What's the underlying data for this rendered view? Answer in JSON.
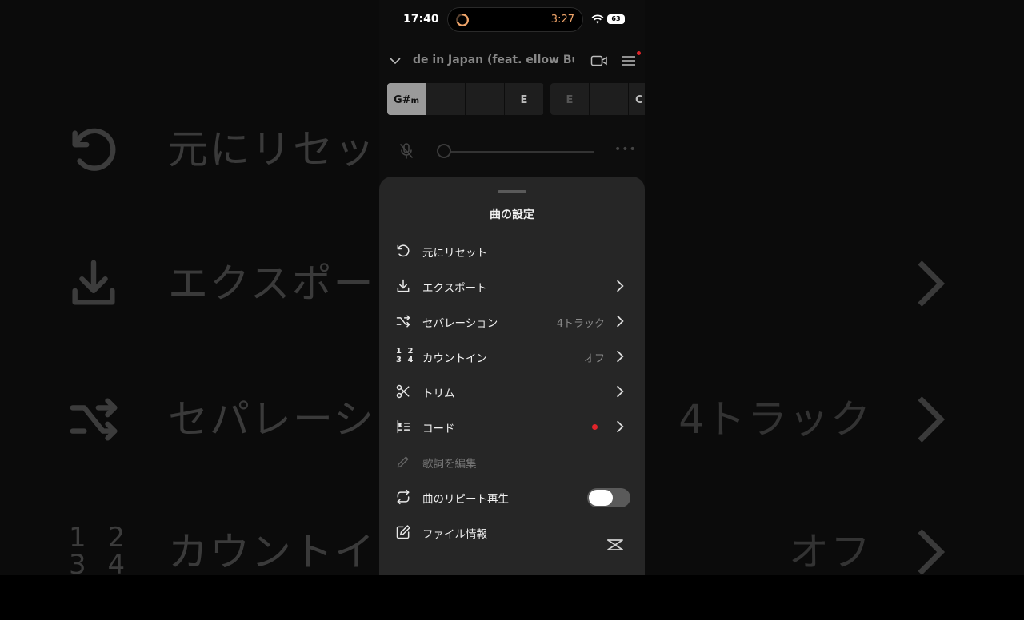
{
  "status_bar": {
    "time": "17:40",
    "timer": "3:27",
    "battery": "63"
  },
  "header": {
    "song_title": "de in Japan (feat. ellow Buck"
  },
  "chords": {
    "group1": [
      "G#m",
      "",
      "",
      "E"
    ],
    "group2": [
      "E",
      "",
      "C"
    ]
  },
  "sheet": {
    "title": "曲の設定",
    "items": [
      {
        "label": "元にリセット",
        "value": "",
        "icon": "reset-icon"
      },
      {
        "label": "エクスポート",
        "value": "",
        "icon": "download-icon"
      },
      {
        "label": "セパレーション",
        "value": "4トラック",
        "icon": "shuffle-icon"
      },
      {
        "label": "カウントイン",
        "value": "オフ",
        "icon": "count-in-icon"
      },
      {
        "label": "トリム",
        "value": "",
        "icon": "scissors-icon"
      },
      {
        "label": "コード",
        "value": "",
        "icon": "chord-icon"
      },
      {
        "label": "歌詞を編集",
        "value": "",
        "icon": "pencil-icon"
      },
      {
        "label": "曲のリピート再生",
        "value": "",
        "icon": "repeat-icon"
      },
      {
        "label": "ファイル情報",
        "value": "",
        "icon": "edit-box-icon"
      }
    ],
    "repeat_enabled": false
  },
  "background": {
    "rows": [
      "元にリセッ",
      "エクスポー",
      "セパレーシ",
      "カウントイ"
    ],
    "values": [
      "",
      "",
      "4トラック",
      "オフ"
    ],
    "count_digits_top": "1 2",
    "count_digits_bottom": "3 4"
  },
  "count_in_icon_digits": {
    "top": "1 2",
    "bottom": "3 4"
  },
  "colors": {
    "accent_red": "#e0242a",
    "sheet_bg": "#262626",
    "timer_orange": "#f0a56a"
  }
}
